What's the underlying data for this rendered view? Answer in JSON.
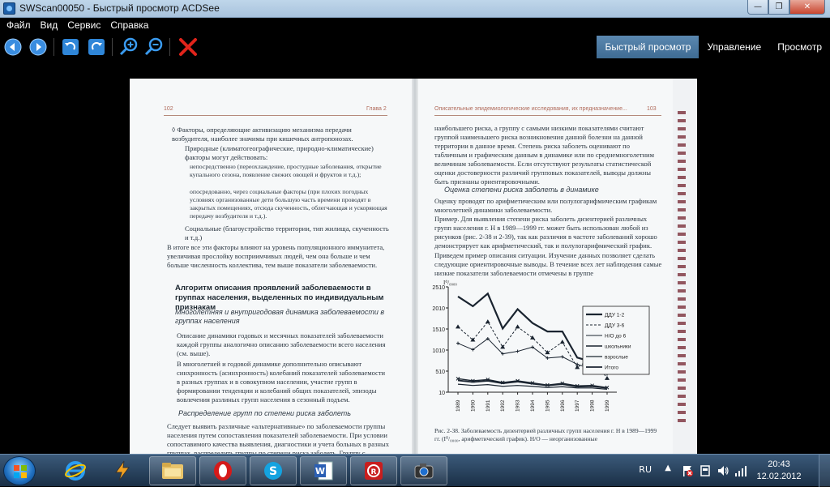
{
  "window": {
    "title": "SWScan00050 - Быстрый просмотр ACDSee",
    "minimize_label": "—",
    "maximize_label": "❐",
    "close_label": "✕"
  },
  "menu": [
    "Файл",
    "Вид",
    "Сервис",
    "Справка"
  ],
  "toolbar": {
    "icons": [
      "back-arrow-icon",
      "forward-arrow-icon",
      "rotate-left-icon",
      "rotate-right-icon",
      "zoom-in-icon",
      "zoom-out-icon",
      "delete-icon"
    ],
    "accent": "#3a8de0",
    "delete_color": "#e0241b"
  },
  "modes": [
    {
      "label": "Быстрый просмотр",
      "active": true
    },
    {
      "label": "Управление",
      "active": false
    },
    {
      "label": "Просмотр",
      "active": false
    }
  ],
  "scan": {
    "left_page": {
      "number": "102",
      "header_right": "Глава 2",
      "para1": "◊  Факторы, определяющие активизацию механизма передачи возбудителя, наиболее значимы при кишечных антропонозах.",
      "para2": "Природные (климатогеографические, природно-климатические) факторы могут действовать:",
      "bullet1": "непосредственно (переохлаждение, простудные заболевания, открытие купального сезона, появление свежих овощей и фруктов и т.д.);",
      "bullet2": "опосредованно, через социальные факторы (при плохих погодных условиях организованные дети большую часть времени проводят в закрытых помещениях, отсюда скученность, облегчающая и ускоряющая передачу возбудителя и т.д.).",
      "para3": "Социальные (благоустройство территории, тип жилища, скученность и т.д.)",
      "para4": "В итоге все эти факторы влияют на уровень популяционного иммунитета, увеличивая прослойку восприимчивых людей, чем она больше и чем больше численность коллектива, тем выше показатели заболеваемости.",
      "heading": "Алгоритм описания проявлений заболеваемости в группах населения, выделенных по индивидуальным признакам",
      "subhead1": "Многолетняя и внутригодовая динамика заболеваемости в группах населения",
      "bullet3": "Описание динамики годовых и месячных показателей заболеваемости каждой группы аналогично описанию заболеваемости всего населения (см. выше).",
      "bullet4": "В многолетней и годовой динамике дополнительно описывают синхронность (асинхронность) колебаний показателей заболеваемости в разных группах и в совокупном населении, участие групп в формировании тенденции и колебаний общих показателей, эпизоды вовлечения разлиных групп населения в сезонный подъем.",
      "subhead2": "Распределение групп по степени риска заболеть",
      "para5": "Следует выявить различные «альтернативные» по заболеваемости группы населения путем сопоставления показателей заболеваемости. При условии сопоставимого качества выявления, диагностики и учета больных в разных группах, распределить группы по степени риска заболеть. Группу с самыми высокими показателями рассматривают как группу"
    },
    "right_page": {
      "header_left": "Описательные эпидемиологические исследования, их предназначение...",
      "number": "103",
      "para1": "наибольшего риска, а группу с самыми низкими показателями считают группой наименьшего риска возникновения данной болезни на данной территории в данное время. Степень риска заболеть оценивают по табличным и графическим данным в динамике или по среднемноголетним величинам заболеваемости. Если отсутствуют результаты статистической оценки достоверности различий групповых показателей, выводы должны быть признаны ориентировочными.",
      "subhead": "Оценка степени риска заболеть в динамике",
      "para2": "Оценку проводят по арифметическим или полулогарифмическим графикам многолетней динамики заболеваемости.",
      "para3": "Пример. Для выявления степени риска заболеть дизентерией различных групп населения г. Н в 1989—1999 гг. может быть использован любой из рисунков (рис. 2-38 и 2-39), так как различия в частоте заболеваний хорошо демонстрирует как арифметический, так и полулогарифмический график.",
      "para4": "Приведем пример описания ситуации. Изучение данных позволяет сделать следующие ориентировочные выводы. В течение всех лет наблюдения самые низкие показатели заболеваемости отмечены в группе",
      "caption": "Рис. 2-38. Заболеваемость дизентерией различных групп населения г. Н в 1989—1999 гг. (I⁰/₀₀₀₀, арифметический график). Н/О — неорганизованные"
    }
  },
  "chart_data": {
    "type": "line",
    "title": "",
    "ylabel": "I⁰/₀₀₀₀",
    "xlabel": "",
    "ylim": [
      10,
      2510
    ],
    "yticks": [
      "2510",
      "2010",
      "1510",
      "1010",
      "510",
      "10"
    ],
    "x": [
      "1989",
      "1990",
      "1991",
      "1992",
      "1993",
      "1994",
      "1995",
      "1996",
      "1997",
      "1998",
      "1999"
    ],
    "legend_position": "right",
    "series": [
      {
        "name": "ДДУ 1-2",
        "values": [
          2280,
          2050,
          2350,
          1520,
          1980,
          1650,
          1450,
          1450,
          830,
          730,
          540
        ]
      },
      {
        "name": "ДДУ 3-6",
        "values": [
          1560,
          1250,
          1680,
          1080,
          1560,
          1300,
          950,
          1200,
          600,
          830,
          340
        ]
      },
      {
        "name": "Н/О до 6",
        "values": [
          1170,
          1020,
          1280,
          920,
          980,
          1080,
          820,
          850,
          670,
          560,
          440
        ]
      },
      {
        "name": "школьники",
        "values": [
          330,
          280,
          310,
          240,
          280,
          230,
          180,
          220,
          160,
          170,
          120
        ]
      },
      {
        "name": "взрослые",
        "values": [
          200,
          170,
          190,
          150,
          170,
          150,
          120,
          140,
          110,
          110,
          80
        ]
      },
      {
        "name": "Итого",
        "values": [
          290,
          250,
          280,
          220,
          260,
          210,
          170,
          200,
          140,
          150,
          110
        ]
      }
    ]
  },
  "taskbar": {
    "apps": [
      "ie-icon",
      "winamp-icon",
      "explorer-folder-icon",
      "opera-icon",
      "skype-icon",
      "word-icon",
      "finereader-icon",
      "acdsee-camera-icon"
    ],
    "lang": "RU",
    "time": "20:43",
    "date": "12.02.2012"
  }
}
